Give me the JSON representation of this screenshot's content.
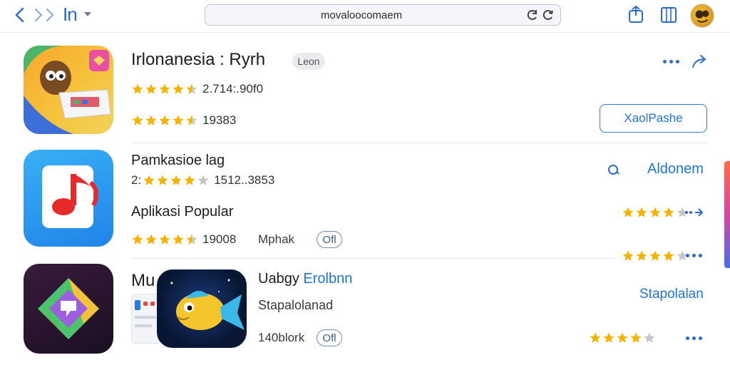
{
  "toolbar": {
    "title": "In",
    "url": "movaloocomaem",
    "back_icon": "chevron-left-icon",
    "forward_icon": "chevron-right-icon",
    "reload_icon": "reload-icon",
    "share_icon": "share-icon",
    "tabs_icon": "tabs-icon"
  },
  "apps": [
    {
      "title": "Irlonanesia : Ryrh",
      "badge": "Leon",
      "rating1": {
        "stars": 4.5,
        "text": "2.714:.90f0"
      },
      "rating2": {
        "stars": 4.5,
        "text": "19383"
      },
      "action_label": "XaolPashe"
    },
    {
      "title": "Pamkasioe lag",
      "rating": {
        "prefix": "2:",
        "stars": 4,
        "text": "1512..3853"
      },
      "side_label": "Aldonem",
      "section_label": "Aplikasi Popular",
      "rating2": {
        "stars": 4.5,
        "text": "19008"
      },
      "meta_label": "Mphak",
      "pill_label": "Ofl",
      "right_ratings": [
        {
          "stars": 4
        },
        {
          "stars": 4
        }
      ]
    },
    {
      "title_prefix": "Mu",
      "title": "Uabgy",
      "title_link": "Erolbnn",
      "subtitle": "Stapalolanad",
      "side_label": "Stapolalan",
      "meta_label": "140blork",
      "pill_label": "Ofl",
      "right_rating": {
        "stars": 4
      }
    }
  ],
  "colors": {
    "accent": "#1f74d8",
    "star": "#f5b301",
    "star_empty": "#c7c7c7"
  }
}
